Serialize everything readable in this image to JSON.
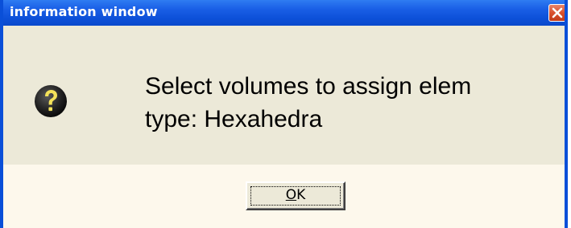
{
  "window": {
    "title": "information window",
    "close_icon": "close-icon",
    "colors": {
      "titlebar": "#0d51d9",
      "frame": "#0a4fd8",
      "content_bg": "#ece9d8",
      "footer_bg": "#fdf8ec",
      "close_button": "#d9502d"
    }
  },
  "dialog": {
    "icon": "question-icon",
    "message_line1": "Select volumes to assign elem",
    "message_line2": "type: Hexahedra",
    "ok_button": {
      "mnemonic": "O",
      "rest": "K"
    }
  }
}
